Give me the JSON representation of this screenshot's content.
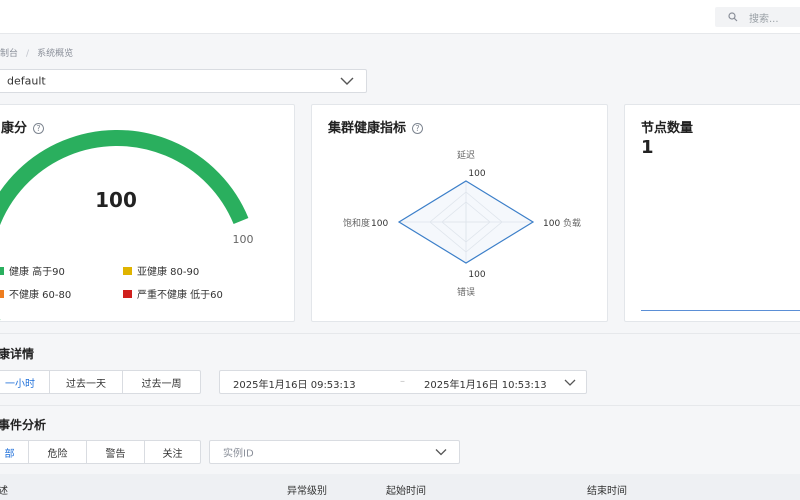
{
  "header": {
    "search_placeholder": "搜索..."
  },
  "breadcrumb": {
    "root": "制台",
    "sep": "/",
    "current": "系统概览"
  },
  "namespace_select": {
    "value": "default"
  },
  "health_card": {
    "title": "康分",
    "score": "100",
    "gauge_max_label": "100",
    "score_fraction": 1.0,
    "legend": [
      {
        "label": "健康 高于90",
        "color": "#2aaf5e"
      },
      {
        "label": "亚健康 80-90",
        "color": "#e0b400"
      },
      {
        "label": "不健康 60-80",
        "color": "#ee7d1f"
      },
      {
        "label": "严重不健康 低于60",
        "color": "#d0201d"
      }
    ]
  },
  "radar_card": {
    "title": "集群健康指标",
    "axes": {
      "top": {
        "name": "延迟",
        "value": "100"
      },
      "right": {
        "name": "负载",
        "value": "100"
      },
      "bottom": {
        "name": "错误",
        "value": "100"
      },
      "left": {
        "name": "饱和度",
        "value": "100"
      }
    }
  },
  "nodes_card": {
    "title": "节点数量",
    "value": "1"
  },
  "detail_section": {
    "title": "康详情",
    "time_buttons": [
      "一小时",
      "过去一天",
      "过去一周"
    ],
    "active_index": 0,
    "range_start": "2025年1月16日 09:53:13",
    "range_sep": "–",
    "range_end": "2025年1月16日 10:53:13"
  },
  "event_section": {
    "title": "事件分析",
    "filter_buttons": [
      "部",
      "危险",
      "警告",
      "关注"
    ],
    "active_index": 0,
    "instance_select_placeholder": "实例ID"
  },
  "table": {
    "columns": [
      "述",
      "异常级别",
      "起始时间",
      "结束时间"
    ]
  },
  "colors": {
    "accent": "#1e6fd9",
    "gauge_green": "#2aaf5e",
    "radar_blue": "#3c7fc9"
  }
}
